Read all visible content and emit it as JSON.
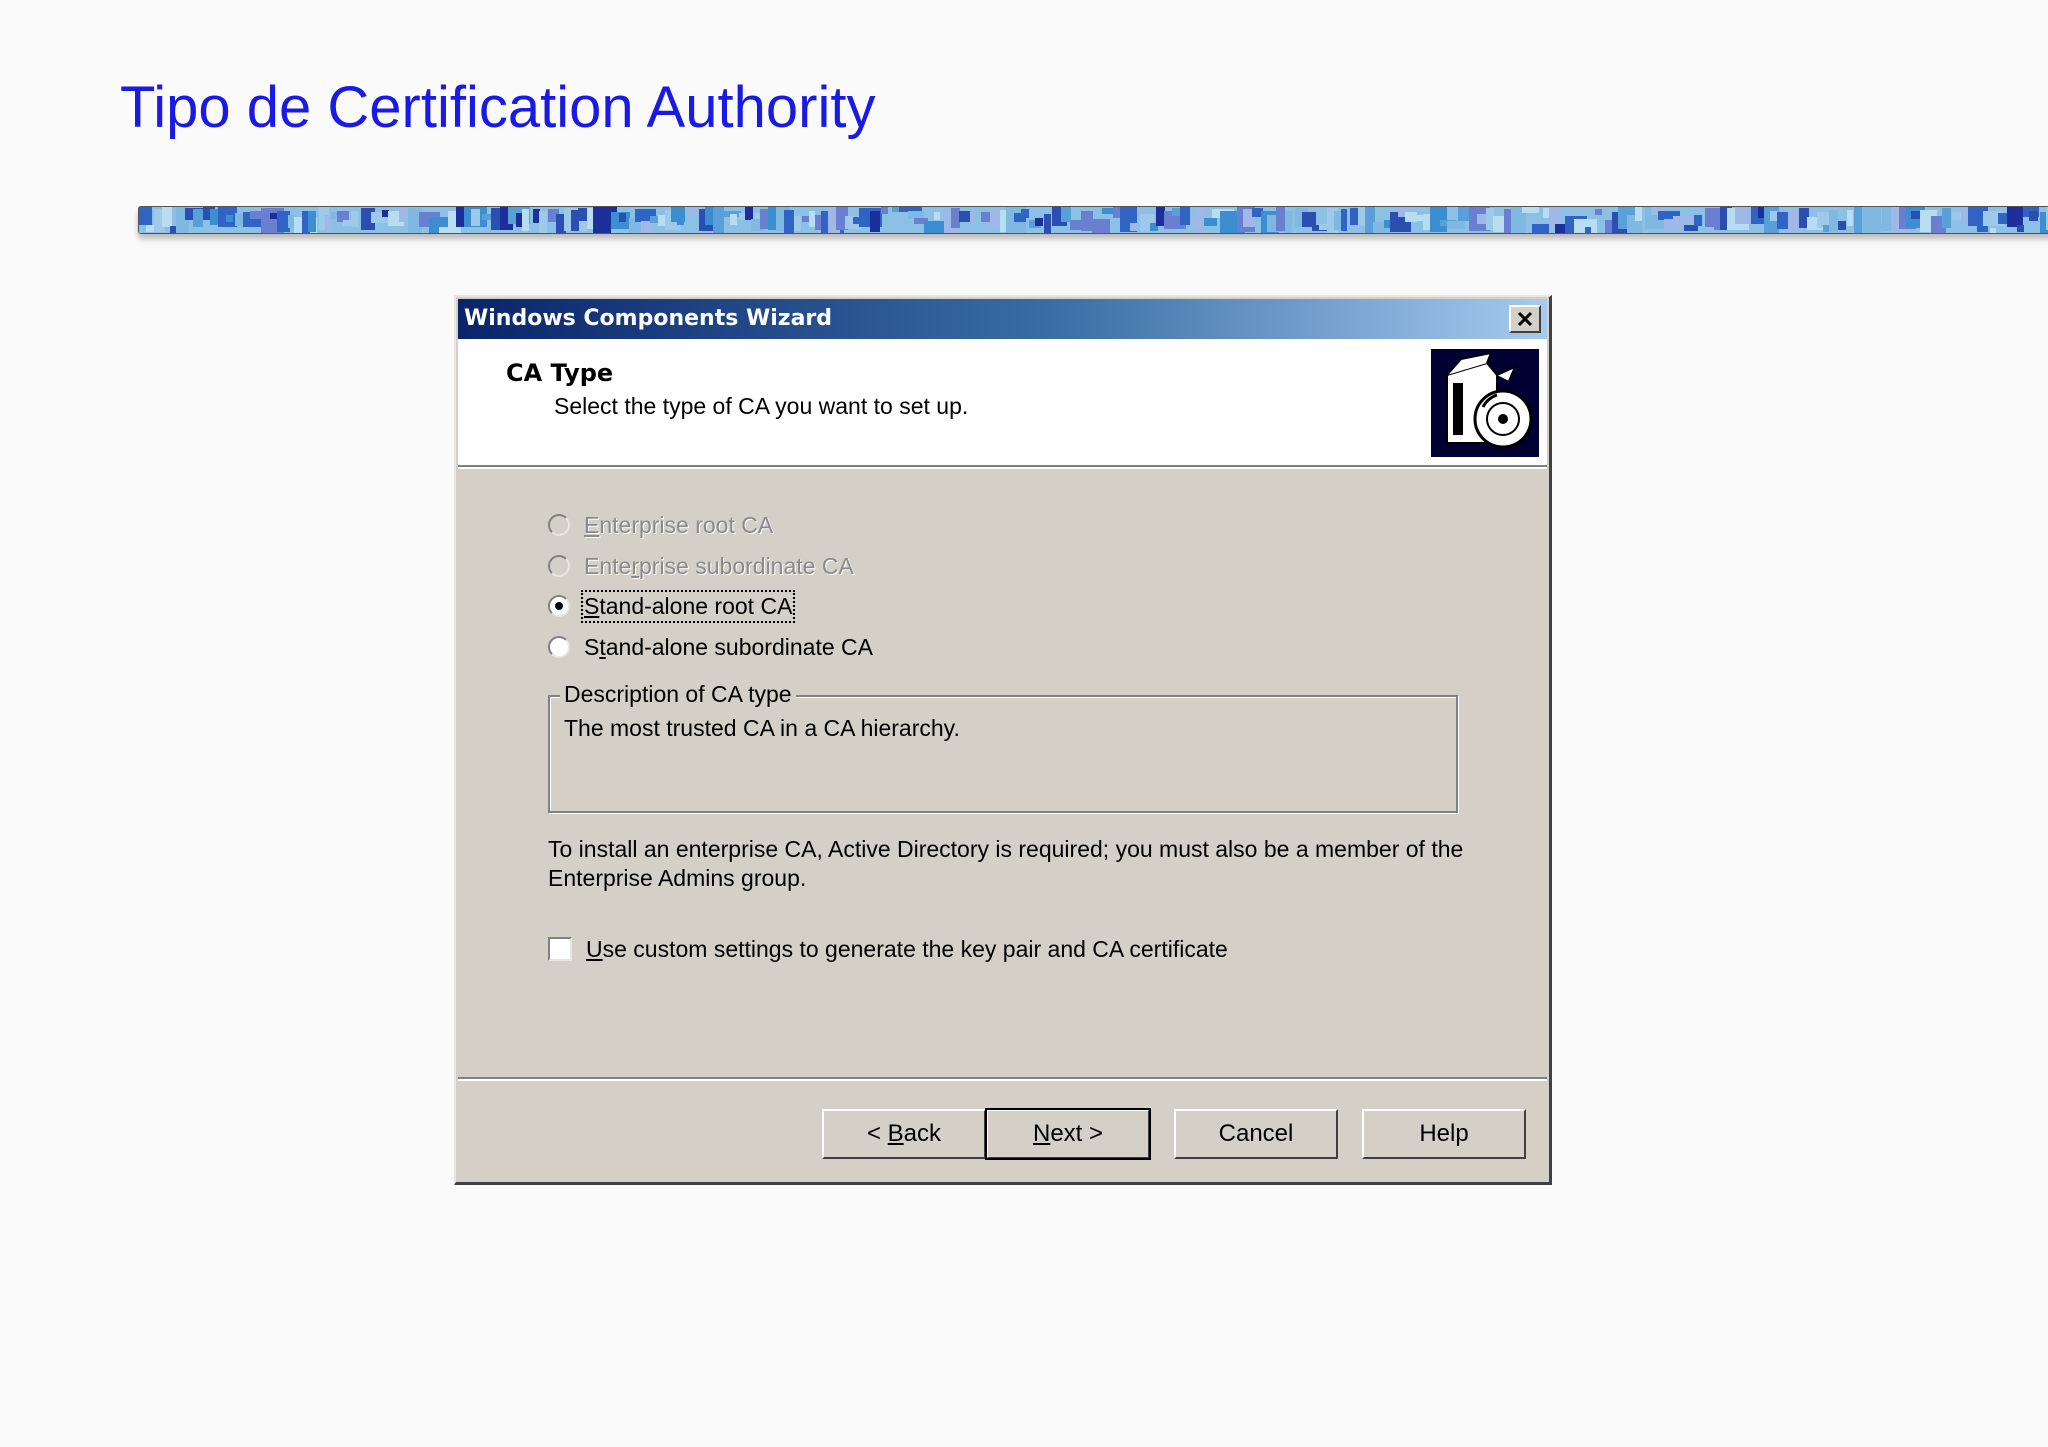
{
  "slide": {
    "title": "Tipo de Certification Authority"
  },
  "dialog": {
    "title": "Windows Components Wizard",
    "close_icon": "close-icon",
    "header": {
      "title": "CA Type",
      "subtitle": "Select the type of CA you want to set up.",
      "icon": "cd-box-icon"
    },
    "options": [
      {
        "pre": "",
        "ul": "E",
        "post": "nterprise root CA",
        "enabled": false,
        "selected": false
      },
      {
        "pre": "Ente",
        "ul": "r",
        "post": "prise subordinate CA",
        "enabled": false,
        "selected": false
      },
      {
        "pre": "",
        "ul": "S",
        "post": "tand-alone root CA",
        "enabled": true,
        "selected": true
      },
      {
        "pre": "S",
        "ul": "t",
        "post": "and-alone subordinate CA",
        "enabled": true,
        "selected": false
      }
    ],
    "description": {
      "legend": "Description of CA type",
      "text": "The most trusted CA in a CA hierarchy."
    },
    "info_text": "To install an enterprise CA, Active Directory is required; you must also be a member of the Enterprise Admins group.",
    "custom_settings": {
      "ul": "U",
      "rest": "se custom settings to generate the key pair and CA certificate",
      "checked": false
    },
    "buttons": {
      "back": {
        "pre": "< ",
        "ul": "B",
        "post": "ack"
      },
      "next": {
        "pre": "",
        "ul": "N",
        "post": "ext >"
      },
      "cancel": "Cancel",
      "help": "Help"
    }
  },
  "colors": {
    "slide_title": "#1a1ae6",
    "titlebar_start": "#0a246a",
    "titlebar_end": "#a6caf0",
    "dialog_face": "#d4d0c8"
  }
}
